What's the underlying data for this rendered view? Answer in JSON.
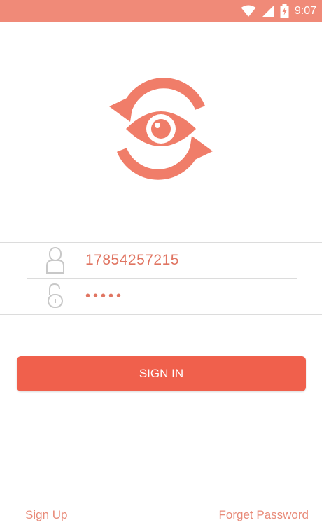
{
  "status_bar": {
    "time": "9:07",
    "icons": [
      "wifi-icon",
      "cell-signal-icon",
      "battery-charging-icon"
    ],
    "background": "#f08a78"
  },
  "logo": {
    "icon": "eye-refresh-logo",
    "color": "#f07d69"
  },
  "login": {
    "username_icon": "user-icon",
    "username_value": "17854257215",
    "password_icon": "unlock-icon",
    "password_value": "•••••"
  },
  "signin_button": {
    "label": "SIGN IN",
    "color": "#f0604c"
  },
  "links": {
    "sign_up": "Sign Up",
    "forget_password": "Forget Password",
    "color": "#e88a78"
  }
}
